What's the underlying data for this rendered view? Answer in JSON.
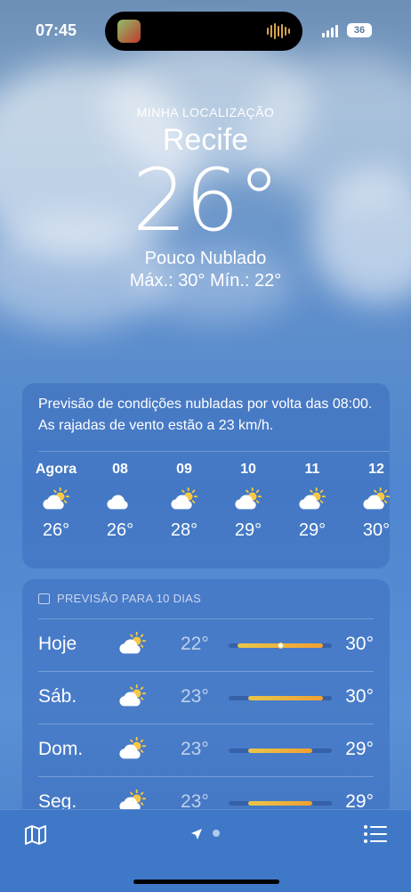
{
  "status": {
    "time": "07:45",
    "battery": "36"
  },
  "hero": {
    "location_label": "MINHA LOCALIZAÇÃO",
    "city": "Recife",
    "temperature": "26°",
    "condition": "Pouco Nublado",
    "hilo": "Máx.: 30°  Mín.: 22°"
  },
  "hourly": {
    "summary": "Previsão de condições nubladas por volta das 08:00. As rajadas de vento estão a 23 km/h.",
    "items": [
      {
        "label": "Agora",
        "icon": "partly-sunny-icon",
        "temp": "26°"
      },
      {
        "label": "08",
        "icon": "cloud-icon",
        "temp": "26°"
      },
      {
        "label": "09",
        "icon": "partly-sunny-icon",
        "temp": "28°"
      },
      {
        "label": "10",
        "icon": "partly-sunny-icon",
        "temp": "29°"
      },
      {
        "label": "11",
        "icon": "partly-sunny-icon",
        "temp": "29°"
      },
      {
        "label": "12",
        "icon": "partly-sunny-icon",
        "temp": "30°"
      }
    ]
  },
  "daily": {
    "title": "PREVISÃO PARA 10 DIAS",
    "range_min": 22,
    "range_max": 30,
    "days": [
      {
        "day": "Hoje",
        "icon": "partly-sunny-icon",
        "low": "22°",
        "high": "30°",
        "low_value": 22,
        "high_value": 30,
        "current": 26
      },
      {
        "day": "Sáb.",
        "icon": "partly-sunny-icon",
        "low": "23°",
        "high": "30°",
        "low_value": 23,
        "high_value": 30
      },
      {
        "day": "Dom.",
        "icon": "partly-sunny-icon",
        "low": "23°",
        "high": "29°",
        "low_value": 23,
        "high_value": 29
      },
      {
        "day": "Seg.",
        "icon": "partly-sunny-icon",
        "low": "23°",
        "high": "29°",
        "low_value": 23,
        "high_value": 29
      }
    ]
  },
  "tabbar": {
    "map_icon": "map-icon",
    "location_icon": "location-arrow-icon",
    "list_icon": "list-icon"
  },
  "colors": {
    "sky": "#5a90d6",
    "card": "#3c6ebe",
    "bar_start": "#e9c64a",
    "bar_end": "#f0a030"
  }
}
